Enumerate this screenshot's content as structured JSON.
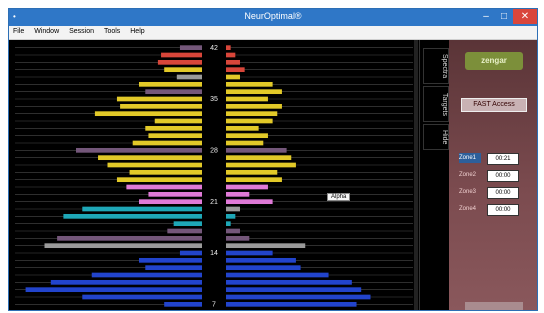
{
  "window": {
    "title": "NeurOptimal®",
    "app_icon": "•",
    "controls": {
      "minimize": "–",
      "maximize": "□",
      "close": "✕"
    }
  },
  "menu": [
    "File",
    "Window",
    "Session",
    "Tools",
    "Help"
  ],
  "axis_labels": [
    "42",
    "35",
    "28",
    "21",
    "14",
    "7"
  ],
  "side_tabs": [
    "Spectra",
    "Targets",
    "Hide"
  ],
  "panel": {
    "logo": "zengar",
    "fast_access": "FAST Access",
    "zones": [
      {
        "label": "Zone1",
        "value": "00:21"
      },
      {
        "label": "Zone2",
        "value": "00:00"
      },
      {
        "label": "Zone3",
        "value": "00:00"
      },
      {
        "label": "Zone4",
        "value": "00:00"
      }
    ]
  },
  "tooltip": "Alpha",
  "colors": {
    "red": "#d8463a",
    "yellow": "#e2c928",
    "purple": "#74577a",
    "pink": "#e07ad8",
    "cyan": "#1ea7b7",
    "gray": "#9a9a9a",
    "blue": "#2244cc"
  },
  "chart_data": {
    "type": "bar",
    "description_of_axis": "Frequency bins 1-42 Hz, mirrored left/right",
    "categories": [
      42,
      41,
      40,
      39,
      38,
      37,
      36,
      35,
      34,
      33,
      32,
      31,
      30,
      29,
      28,
      27,
      26,
      25,
      24,
      23,
      22,
      21,
      20,
      19,
      18,
      17,
      16,
      15,
      14,
      13,
      12,
      11,
      10,
      9,
      8,
      7
    ],
    "left": [
      14,
      26,
      28,
      24,
      16,
      40,
      36,
      54,
      52,
      68,
      30,
      36,
      34,
      44,
      80,
      66,
      60,
      46,
      54,
      48,
      34,
      40,
      76,
      88,
      18,
      22,
      92,
      100,
      14,
      40,
      36,
      70,
      96,
      112,
      76,
      24
    ],
    "right": [
      2,
      4,
      6,
      8,
      6,
      20,
      24,
      18,
      24,
      22,
      20,
      14,
      18,
      16,
      26,
      28,
      30,
      22,
      24,
      18,
      10,
      20,
      6,
      4,
      2,
      6,
      10,
      34,
      20,
      30,
      32,
      44,
      54,
      58,
      62,
      56
    ],
    "colors_left": [
      "purple",
      "red",
      "red",
      "yellow",
      "gray",
      "yellow",
      "purple",
      "yellow",
      "yellow",
      "yellow",
      "yellow",
      "yellow",
      "yellow",
      "yellow",
      "purple",
      "yellow",
      "yellow",
      "yellow",
      "yellow",
      "pink",
      "pink",
      "pink",
      "cyan",
      "cyan",
      "cyan",
      "purple",
      "purple",
      "gray",
      "blue",
      "blue",
      "blue",
      "blue",
      "blue",
      "blue",
      "blue",
      "blue"
    ],
    "colors_right": [
      "red",
      "red",
      "red",
      "red",
      "yellow",
      "yellow",
      "yellow",
      "yellow",
      "yellow",
      "yellow",
      "yellow",
      "yellow",
      "yellow",
      "yellow",
      "purple",
      "yellow",
      "yellow",
      "yellow",
      "yellow",
      "pink",
      "pink",
      "pink",
      "gray",
      "cyan",
      "cyan",
      "purple",
      "purple",
      "gray",
      "blue",
      "blue",
      "blue",
      "blue",
      "blue",
      "blue",
      "blue",
      "blue"
    ]
  }
}
